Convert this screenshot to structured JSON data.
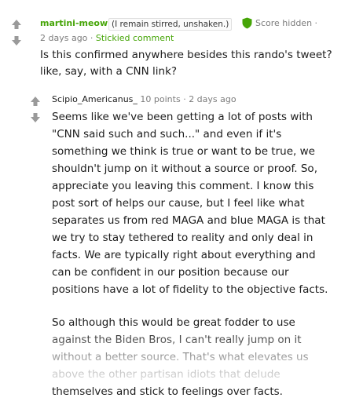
{
  "comment1": {
    "author": "martini-meow",
    "flair": "(I remain stirred, unshaken.)",
    "score": "Score hidden",
    "separator": "·",
    "age": "2 days ago",
    "stickied": "Stickied comment",
    "text": "Is this confirmed anywhere besides this rando's tweet? like, say, with a CNN link?",
    "mod_color": "#46a508"
  },
  "comment2": {
    "author": "Scipio_Americanus_",
    "points": "10 points",
    "separator": "·",
    "age": "2 days ago",
    "paragraphs": [
      "Seems like we've been getting a lot of posts with \"CNN said such and such...\" and even if it's something we think is true or want to be true, we shouldn't jump on it without a source or proof. So, appreciate you leaving this comment. I know this post sort of helps our cause, but I feel like what separates us from red MAGA and blue MAGA is that we try to stay tethered to reality and only deal in facts. We are typically right about everything and can be confident in our position because our positions have a lot of fidelity to the objective facts.",
      "So although this would be great fodder to use against the Biden Bros, I can't really jump on it without a better source. That's what elevates us above the other partisan idiots that delude themselves and stick to feelings over facts."
    ]
  },
  "icons": {
    "upvote": "up-arrow-icon",
    "downvote": "down-arrow-icon",
    "moderator": "shield-icon"
  }
}
